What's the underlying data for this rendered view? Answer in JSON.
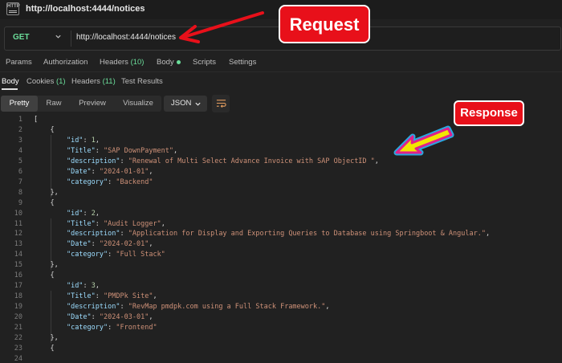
{
  "window": {
    "title": "http://localhost:4444/notices",
    "app_icon_text": "HTTP"
  },
  "request": {
    "method": "GET",
    "url": "http://localhost:4444/notices"
  },
  "request_tabs": [
    {
      "label": "Params"
    },
    {
      "label": "Authorization"
    },
    {
      "label": "Headers",
      "count": "(10)"
    },
    {
      "label": "Body"
    },
    {
      "label": "Scripts"
    },
    {
      "label": "Settings"
    }
  ],
  "response_tabs": [
    {
      "label": "Body"
    },
    {
      "label": "Cookies",
      "count": "(1)"
    },
    {
      "label": "Headers",
      "count": "(11)"
    },
    {
      "label": "Test Results"
    }
  ],
  "view_modes": [
    "Pretty",
    "Raw",
    "Preview",
    "Visualize"
  ],
  "format": "JSON",
  "annotations": {
    "request": "Request",
    "response": "Response"
  },
  "colors": {
    "method": "#6bdd9a",
    "callout": "#e8101a",
    "key": "#9cdcfe",
    "string": "#ce9178",
    "number": "#b5cea8"
  },
  "code_lines": [
    {
      "n": "1",
      "parts": [
        [
          "p",
          "["
        ]
      ]
    },
    {
      "n": "2",
      "parts": [
        [
          "p",
          "    {"
        ]
      ]
    },
    {
      "n": "3",
      "parts": [
        [
          "p",
          "        "
        ],
        [
          "k",
          "\"id\""
        ],
        [
          "p",
          ": "
        ],
        [
          "n",
          "1"
        ],
        [
          "p",
          ","
        ]
      ]
    },
    {
      "n": "4",
      "parts": [
        [
          "p",
          "        "
        ],
        [
          "k",
          "\"Title\""
        ],
        [
          "p",
          ": "
        ],
        [
          "s",
          "\"SAP DownPayment\""
        ],
        [
          "p",
          ","
        ]
      ]
    },
    {
      "n": "5",
      "parts": [
        [
          "p",
          "        "
        ],
        [
          "k",
          "\"description\""
        ],
        [
          "p",
          ": "
        ],
        [
          "s",
          "\"Renewal of Multi Select Advance Invoice with SAP ObjectID \""
        ],
        [
          "p",
          ","
        ]
      ]
    },
    {
      "n": "6",
      "parts": [
        [
          "p",
          "        "
        ],
        [
          "k",
          "\"Date\""
        ],
        [
          "p",
          ": "
        ],
        [
          "s",
          "\"2024-01-01\""
        ],
        [
          "p",
          ","
        ]
      ]
    },
    {
      "n": "7",
      "parts": [
        [
          "p",
          "        "
        ],
        [
          "k",
          "\"category\""
        ],
        [
          "p",
          ": "
        ],
        [
          "s",
          "\"Backend\""
        ]
      ]
    },
    {
      "n": "8",
      "parts": [
        [
          "p",
          "    },"
        ]
      ]
    },
    {
      "n": "9",
      "parts": [
        [
          "p",
          "    {"
        ]
      ]
    },
    {
      "n": "10",
      "parts": [
        [
          "p",
          "        "
        ],
        [
          "k",
          "\"id\""
        ],
        [
          "p",
          ": "
        ],
        [
          "n",
          "2"
        ],
        [
          "p",
          ","
        ]
      ]
    },
    {
      "n": "11",
      "parts": [
        [
          "p",
          "        "
        ],
        [
          "k",
          "\"Title\""
        ],
        [
          "p",
          ": "
        ],
        [
          "s",
          "\"Audit Logger\""
        ],
        [
          "p",
          ","
        ]
      ]
    },
    {
      "n": "12",
      "parts": [
        [
          "p",
          "        "
        ],
        [
          "k",
          "\"description\""
        ],
        [
          "p",
          ": "
        ],
        [
          "s",
          "\"Application for Display and Exporting Queries to Database using Springboot & Angular.\""
        ],
        [
          "p",
          ","
        ]
      ]
    },
    {
      "n": "13",
      "parts": [
        [
          "p",
          "        "
        ],
        [
          "k",
          "\"Date\""
        ],
        [
          "p",
          ": "
        ],
        [
          "s",
          "\"2024-02-01\""
        ],
        [
          "p",
          ","
        ]
      ]
    },
    {
      "n": "14",
      "parts": [
        [
          "p",
          "        "
        ],
        [
          "k",
          "\"category\""
        ],
        [
          "p",
          ": "
        ],
        [
          "s",
          "\"Full Stack\""
        ]
      ]
    },
    {
      "n": "15",
      "parts": [
        [
          "p",
          "    },"
        ]
      ]
    },
    {
      "n": "16",
      "parts": [
        [
          "p",
          "    {"
        ]
      ]
    },
    {
      "n": "17",
      "parts": [
        [
          "p",
          "        "
        ],
        [
          "k",
          "\"id\""
        ],
        [
          "p",
          ": "
        ],
        [
          "n",
          "3"
        ],
        [
          "p",
          ","
        ]
      ]
    },
    {
      "n": "18",
      "parts": [
        [
          "p",
          "        "
        ],
        [
          "k",
          "\"Title\""
        ],
        [
          "p",
          ": "
        ],
        [
          "s",
          "\"PMDPk Site\""
        ],
        [
          "p",
          ","
        ]
      ]
    },
    {
      "n": "19",
      "parts": [
        [
          "p",
          "        "
        ],
        [
          "k",
          "\"description\""
        ],
        [
          "p",
          ": "
        ],
        [
          "s",
          "\"RevMap pmdpk.com using a Full Stack Framework.\""
        ],
        [
          "p",
          ","
        ]
      ]
    },
    {
      "n": "20",
      "parts": [
        [
          "p",
          "        "
        ],
        [
          "k",
          "\"Date\""
        ],
        [
          "p",
          ": "
        ],
        [
          "s",
          "\"2024-03-01\""
        ],
        [
          "p",
          ","
        ]
      ]
    },
    {
      "n": "21",
      "parts": [
        [
          "p",
          "        "
        ],
        [
          "k",
          "\"category\""
        ],
        [
          "p",
          ": "
        ],
        [
          "s",
          "\"Frontend\""
        ]
      ]
    },
    {
      "n": "22",
      "parts": [
        [
          "p",
          "    },"
        ]
      ]
    },
    {
      "n": "23",
      "parts": [
        [
          "p",
          "    {"
        ]
      ]
    },
    {
      "n": "24",
      "parts": [
        [
          "p",
          ""
        ]
      ]
    }
  ]
}
